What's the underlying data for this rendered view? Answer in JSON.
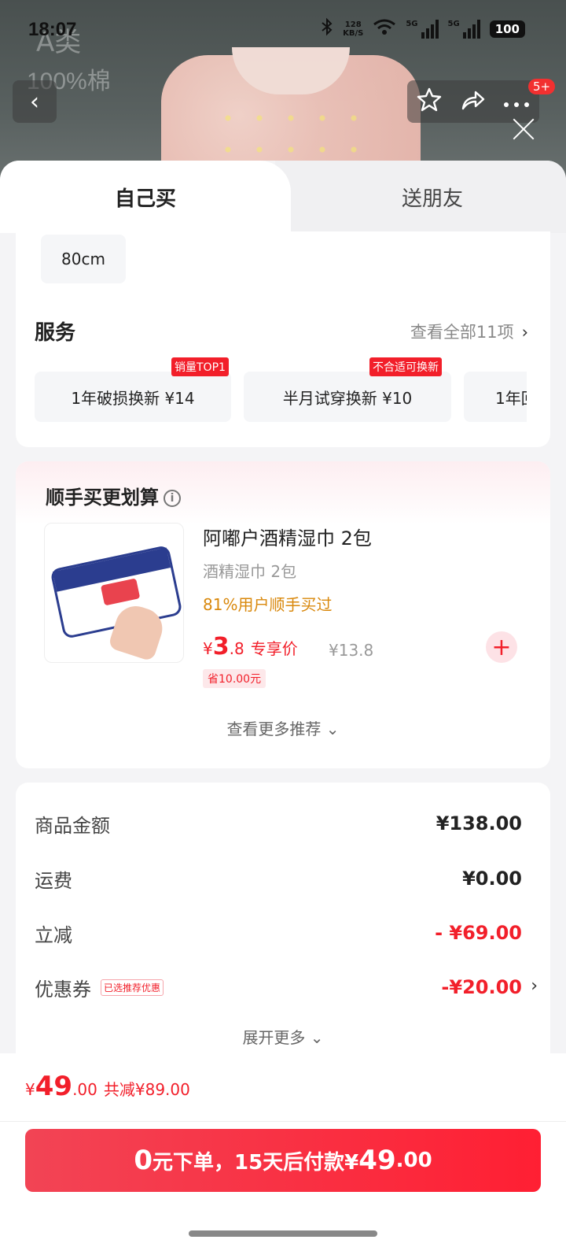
{
  "status": {
    "time": "18:07",
    "net_speed": "128",
    "net_unit": "KB/S",
    "sig1": "5G",
    "sig2": "5G",
    "battery": "100"
  },
  "backdrop": {
    "text_top": "A类",
    "text_cotton": "100%棉"
  },
  "nav": {
    "back_icon": "‹",
    "badge": "5+"
  },
  "tabs": {
    "self": "自己买",
    "friend": "送朋友"
  },
  "spec": {
    "size": "80cm"
  },
  "service": {
    "title": "服务",
    "more": "查看全部11项",
    "items": [
      {
        "label": "1年破损换新  ¥14",
        "tag": "销量TOP1"
      },
      {
        "label": "半月试穿换新  ¥10",
        "tag": "不合适可换新"
      },
      {
        "label": "1年回",
        "tag": ""
      }
    ]
  },
  "addon": {
    "title": "顺手买更划算",
    "name": "阿嘟户酒精湿巾 2包",
    "sub": "酒精湿巾 2包",
    "rate": "81%用户顺手买过",
    "currency": "¥",
    "price_int": "3",
    "price_dec": ".8",
    "price_label": "专享价",
    "orig": "¥13.8",
    "save": "省10.00元",
    "more": "查看更多推荐 ⌄"
  },
  "summary": {
    "rows": [
      {
        "k": "商品金额",
        "v": "¥138.00"
      },
      {
        "k": "运费",
        "v": "¥0.00"
      },
      {
        "k": "立减",
        "v": "- ¥69.00"
      },
      {
        "k": "优惠券",
        "tag": "已选推荐优惠",
        "v": "-¥20.00"
      }
    ],
    "expand": "展开更多 ⌄"
  },
  "footer": {
    "currency": "¥",
    "total_int": "49",
    "total_dec": ".00",
    "reduce": "共减¥89.00",
    "cta_a": "0",
    "cta_b": "元下单，15天后付款¥",
    "cta_c": "49",
    "cta_d": ".00"
  },
  "colors": {
    "accent": "#f21f2a",
    "orange": "#d9880c"
  }
}
